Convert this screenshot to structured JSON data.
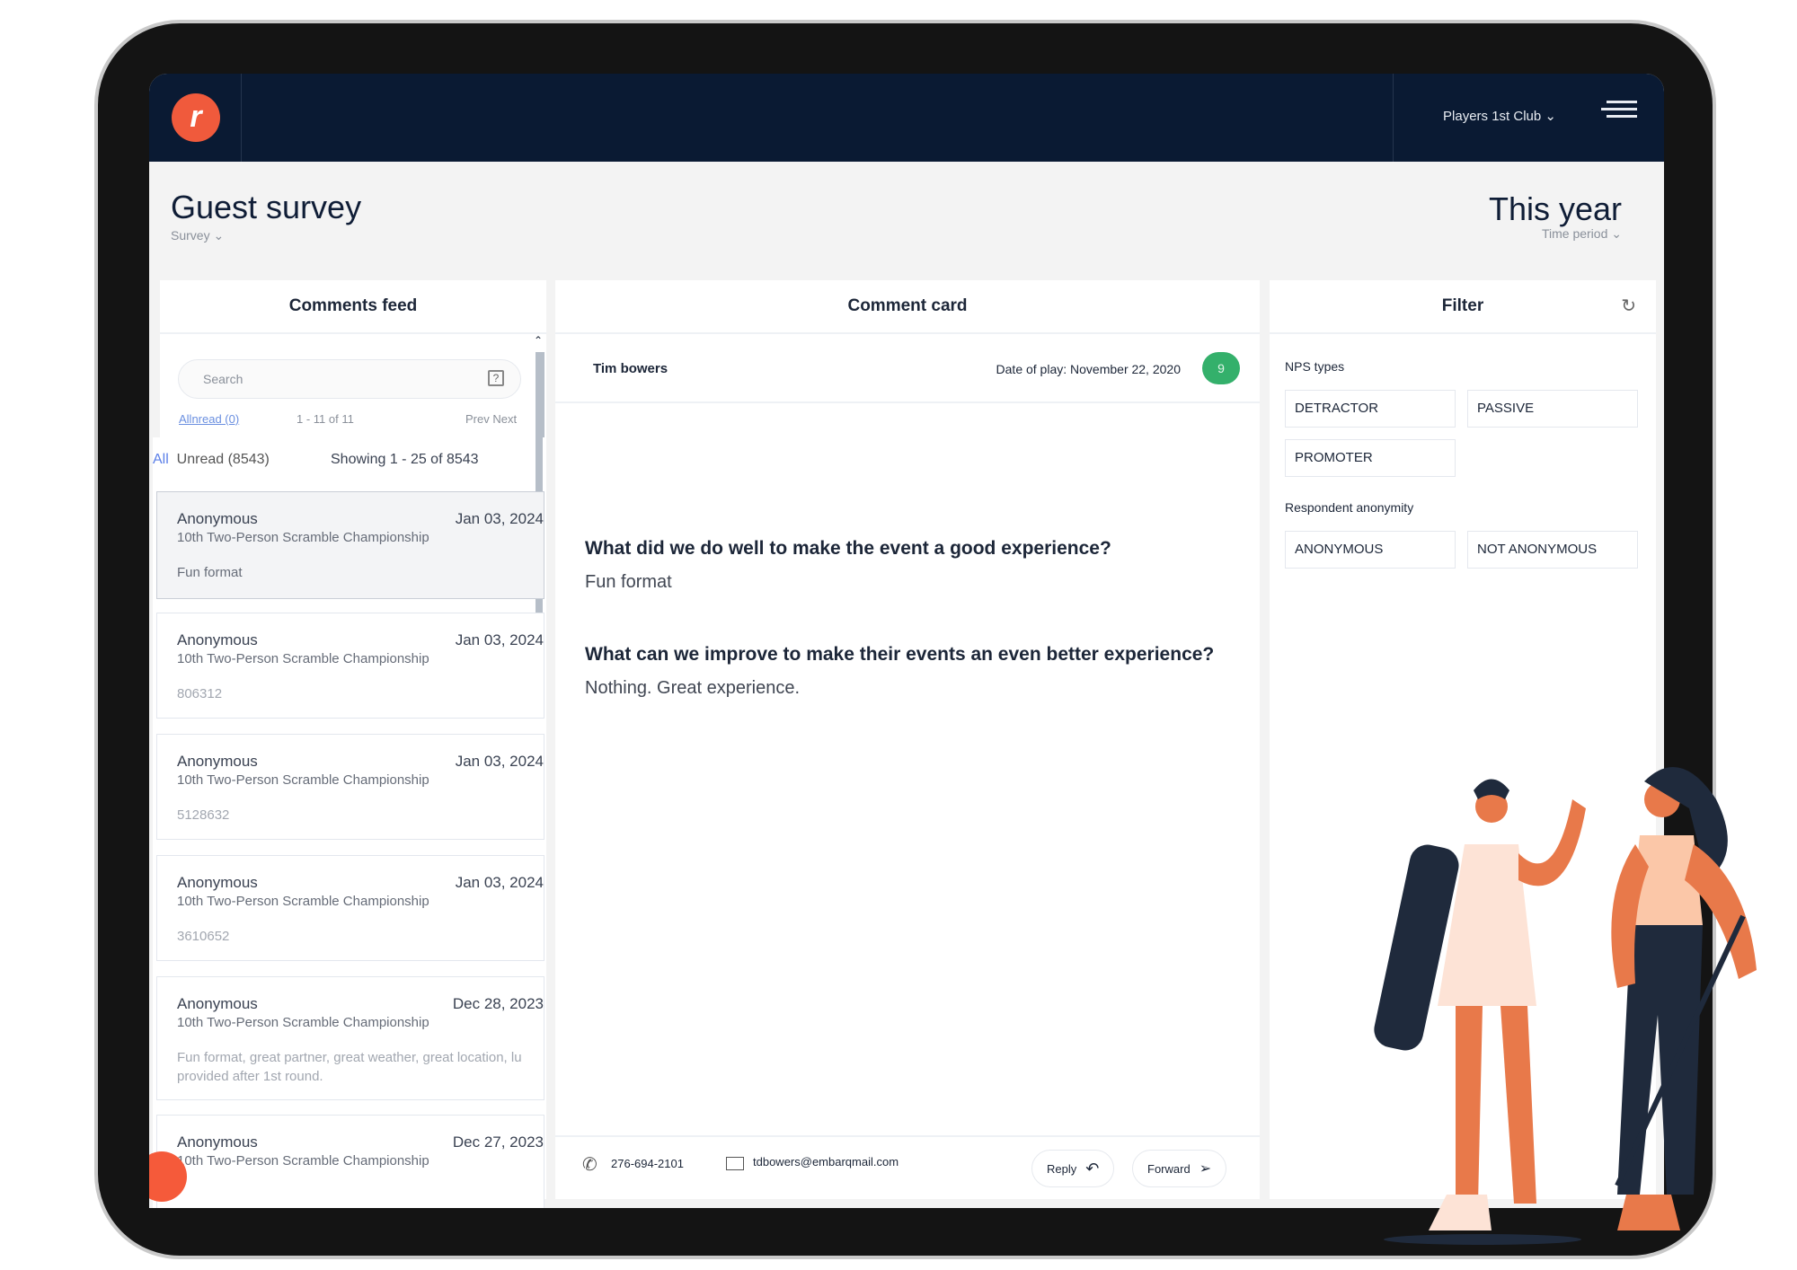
{
  "nav": {
    "club": "Players 1st Club",
    "logo_color": "#f05a3c",
    "bg": "#0a1a33"
  },
  "header": {
    "title": "Guest survey",
    "subtitle": "Survey",
    "period": "This year",
    "period_label": "Time period"
  },
  "feed": {
    "title": "Comments feed",
    "search_placeholder": "Search",
    "allread": "Allnread (0)",
    "range": "1 - 11 of 11",
    "prev": "Prev",
    "next": "Next",
    "all": "All",
    "unread": "Unread (8543)",
    "showing": "Showing 1 - 25 of 8543",
    "items": [
      {
        "name": "Anonymous",
        "date": "Jan 03, 2024",
        "event": "10th Two-Person Scramble Championship",
        "comment": "Fun format"
      },
      {
        "name": "Anonymous",
        "date": "Jan 03, 2024",
        "event": "10th Two-Person Scramble Championship",
        "comment": "806312"
      },
      {
        "name": "Anonymous",
        "date": "Jan 03, 2024",
        "event": "10th Two-Person Scramble Championship",
        "comment": "5128632"
      },
      {
        "name": "Anonymous",
        "date": "Jan 03, 2024",
        "event": "10th Two-Person Scramble Championship",
        "comment": "3610652"
      },
      {
        "name": "Anonymous",
        "date": "Dec 28, 2023",
        "event": "10th Two-Person Scramble Championship",
        "comment": "Fun format, great partner, great weather, great location, lu",
        "comment2": "provided after 1st round."
      },
      {
        "name": "Anonymous",
        "date": "Dec 27, 2023",
        "event": "10th Two-Person Scramble Championship"
      }
    ]
  },
  "card": {
    "title": "Comment card",
    "name": "Tim bowers",
    "date": "Date of play: November 22, 2020",
    "score": "9",
    "score_color": "#34b06b",
    "q1": "What did we do well to make the event a good experience?",
    "a1": "Fun format",
    "q2": "What can we improve to make their events an even better experience?",
    "a2": "Nothing. Great experience.",
    "phone": "276-694-2101",
    "email": "tdbowers@embarqmail.com",
    "reply": "Reply",
    "forward": "Forward"
  },
  "filter": {
    "title": "Filter",
    "nps_label": "NPS types",
    "nps": [
      "DETRACTOR",
      "PASSIVE",
      "PROMOTER"
    ],
    "anon_label": "Respondent anonymity",
    "anon": [
      "ANONYMOUS",
      "NOT ANONYMOUS"
    ]
  }
}
